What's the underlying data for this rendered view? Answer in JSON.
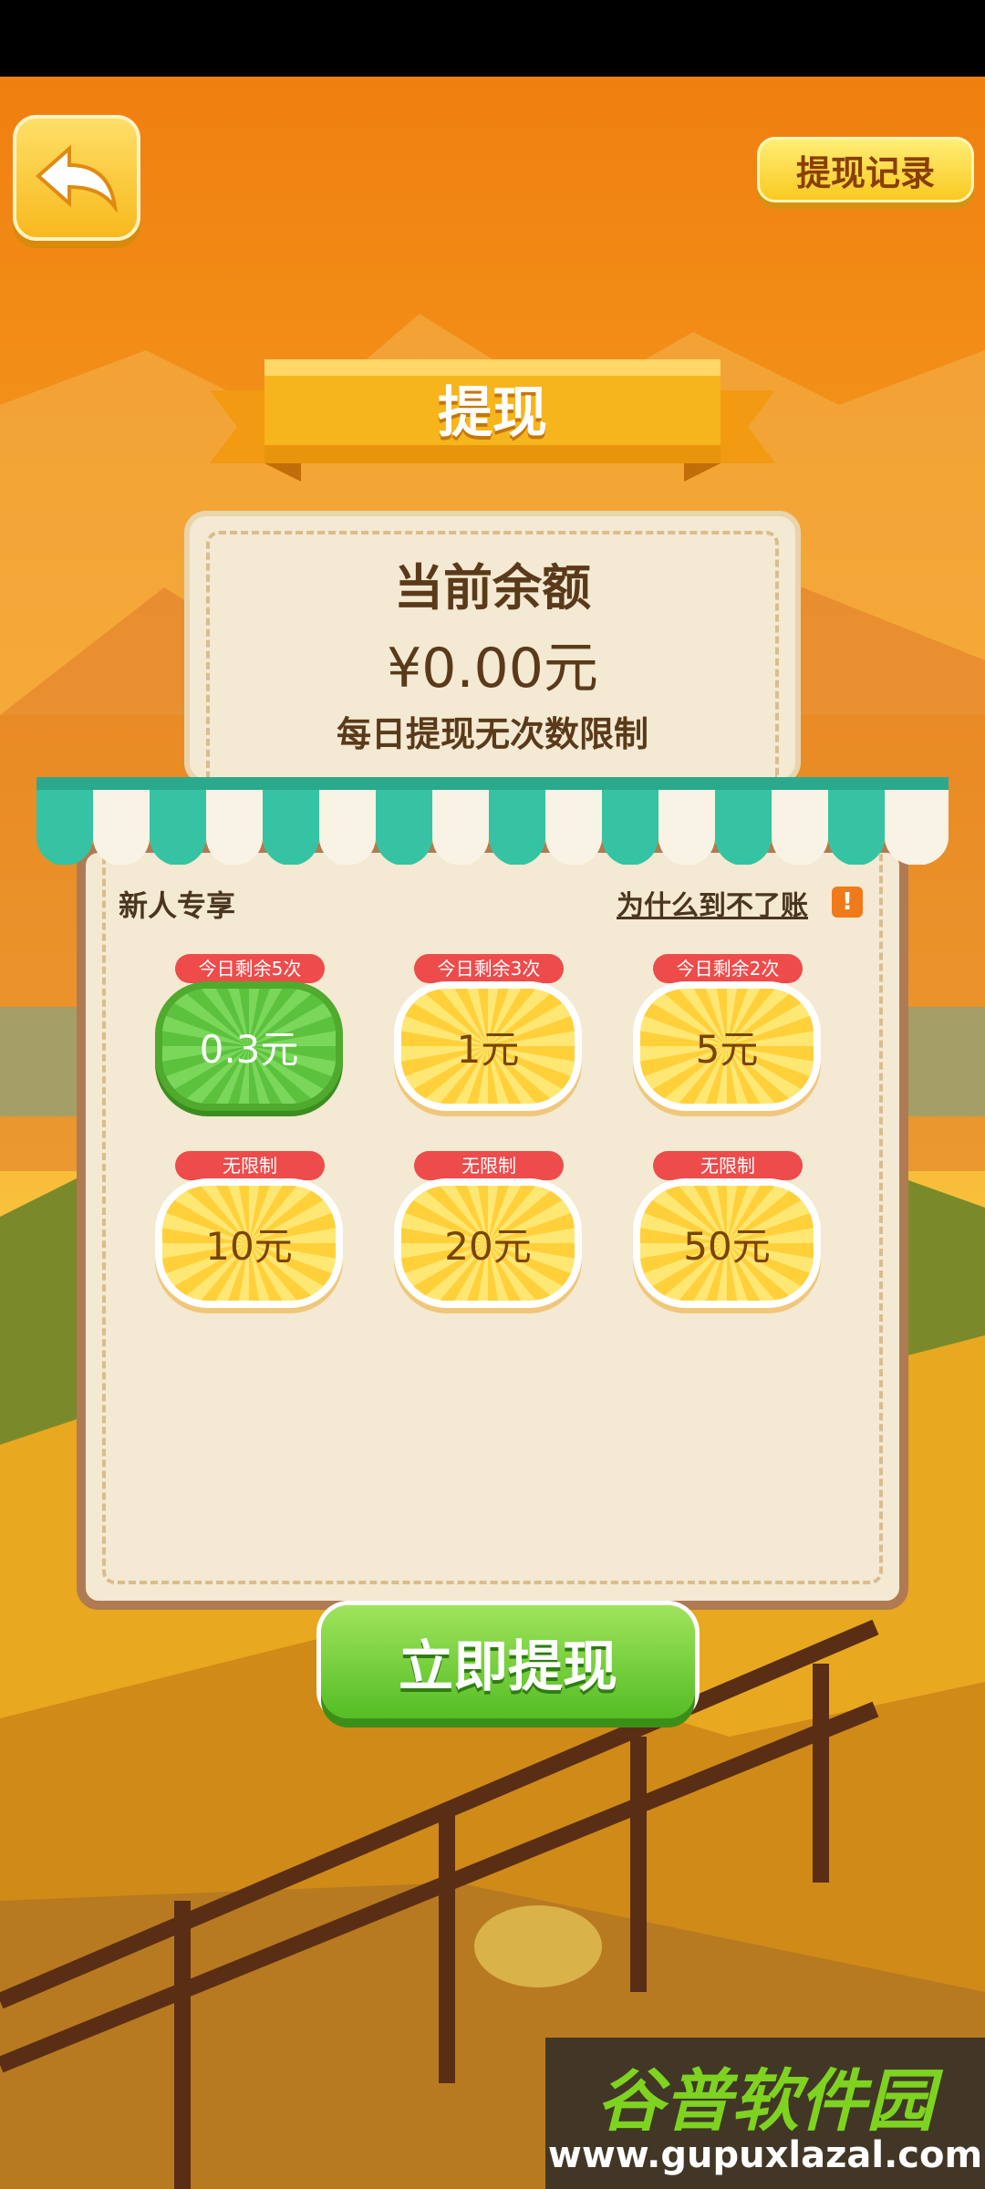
{
  "header": {
    "record_label": "提现记录"
  },
  "title": "提现",
  "balance": {
    "label": "当前余额",
    "amount": "¥0.00元",
    "note": "每日提现无次数限制"
  },
  "section": {
    "label": "新人专享",
    "why_link": "为什么到不了账",
    "warn_symbol": "!"
  },
  "options": [
    {
      "badge": "今日剩余5次",
      "value": "0.3元",
      "selected": true
    },
    {
      "badge": "今日剩余3次",
      "value": "1元",
      "selected": false
    },
    {
      "badge": "今日剩余2次",
      "value": "5元",
      "selected": false
    },
    {
      "badge": "无限制",
      "value": "10元",
      "selected": false
    },
    {
      "badge": "无限制",
      "value": "20元",
      "selected": false
    },
    {
      "badge": "无限制",
      "value": "50元",
      "selected": false
    }
  ],
  "withdraw_label": "立即提现",
  "watermark": {
    "title": "谷普软件园",
    "url": "www.gupuxlazal.com"
  },
  "colors": {
    "accent": "#f7b81b",
    "selected": "#5cc23e",
    "badge": "#ee4b4b",
    "sky": "#f08a16",
    "brown_panel": "#b07b52"
  }
}
